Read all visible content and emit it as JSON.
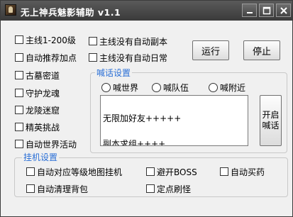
{
  "window": {
    "title": "无上神兵魅影辅助 v1.1",
    "controls": {
      "minimize": "minimize-icon",
      "maximize": "maximize-icon",
      "close": "close-icon"
    }
  },
  "left_options": [
    {
      "label": "主线1-200级",
      "checked": false
    },
    {
      "label": "自动推荐加点",
      "checked": false
    },
    {
      "label": "古墓密道",
      "checked": false
    },
    {
      "label": "守护龙魂",
      "checked": false
    },
    {
      "label": "龙陵迷窟",
      "checked": false
    },
    {
      "label": "精英挑战",
      "checked": false
    },
    {
      "label": "自动世界活动",
      "checked": false
    }
  ],
  "middle_options": [
    {
      "label": "主线没有自动副本",
      "checked": false
    },
    {
      "label": "主线没有自动日常",
      "checked": false
    }
  ],
  "buttons": {
    "run": "运行",
    "stop": "停止"
  },
  "shout": {
    "group_label": "喊话设置",
    "radios": [
      {
        "label": "喊世界",
        "selected": false
      },
      {
        "label": "喊队伍",
        "selected": false
      },
      {
        "label": "喊附近",
        "selected": false
      }
    ],
    "message_lines": [
      "无限加好友+++++",
      "副本求组++++"
    ],
    "start_button": [
      "开启",
      "喊话"
    ]
  },
  "hangup": {
    "group_label": "挂机设置",
    "options": [
      {
        "label": "自动对应等级地图挂机",
        "checked": false
      },
      {
        "label": "避开BOSS",
        "checked": false
      },
      {
        "label": "自动买药",
        "checked": false
      },
      {
        "label": "自动清理背包",
        "checked": false
      },
      {
        "label": "定点刷怪",
        "checked": false
      }
    ]
  }
}
